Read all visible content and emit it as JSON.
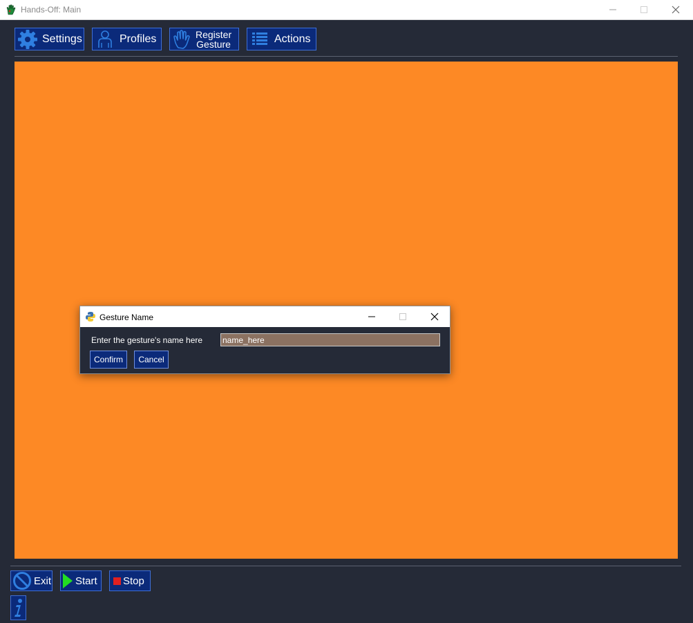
{
  "window": {
    "title": "Hands-Off: Main"
  },
  "toolbar": {
    "settings": "Settings",
    "profiles": "Profiles",
    "register_line1": "Register",
    "register_line2": "Gesture",
    "actions": "Actions"
  },
  "canvas": {
    "color": "#fd8925"
  },
  "dialog": {
    "title": "Gesture Name",
    "prompt": "Enter the gesture's name here",
    "input_value": "name_here",
    "confirm": "Confirm",
    "cancel": "Cancel"
  },
  "bottom": {
    "exit": "Exit",
    "start": "Start",
    "stop": "Stop"
  },
  "icons": {
    "app": "hand-icon",
    "settings": "gear-icon",
    "profiles": "person-icon",
    "register": "hand-outline-icon",
    "actions": "list-icon",
    "exit": "no-entry-icon",
    "start": "play-icon",
    "stop": "stop-icon",
    "info": "info-icon"
  },
  "colors": {
    "background": "#252a37",
    "button": "#0b2a7a",
    "accent_blue": "#2f7fe0",
    "play_green": "#22dd22",
    "stop_red": "#e02020"
  }
}
